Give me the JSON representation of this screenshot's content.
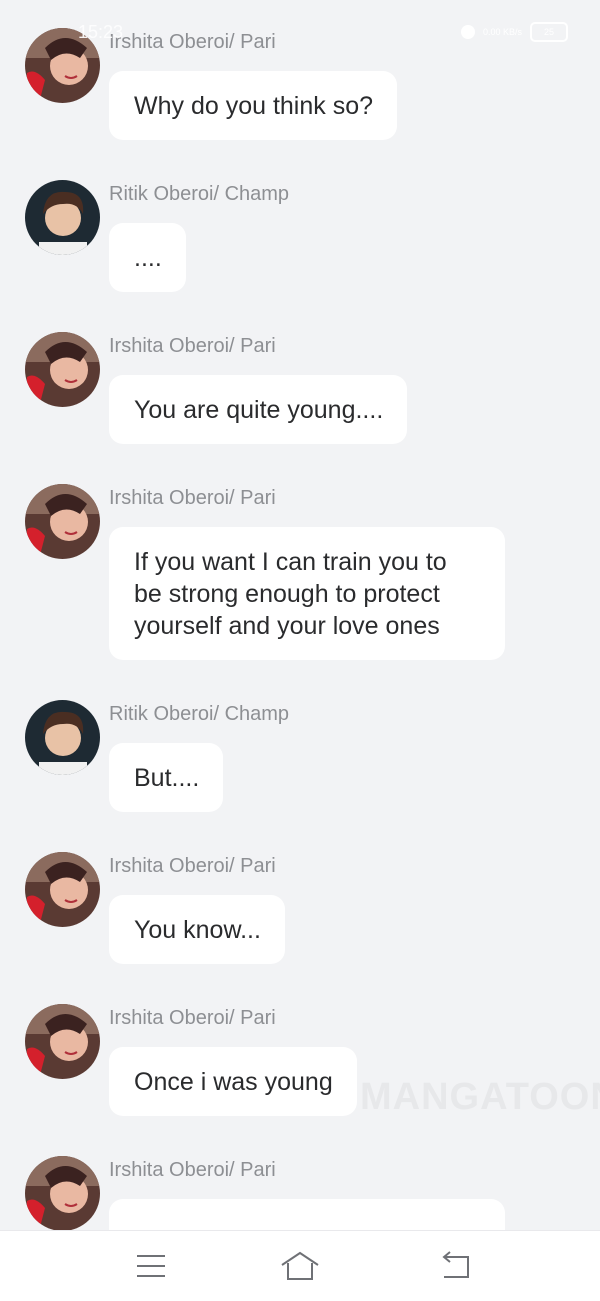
{
  "status_bar": {
    "time": "15:23",
    "net_speed": "0.00 KB/s",
    "battery": "25"
  },
  "watermark": "MANGATOON",
  "messages": [
    {
      "sender": "Irshita Oberoi/ Pari",
      "avatar": "pari-avatar",
      "text": "Why do you think so?"
    },
    {
      "sender": "Ritik Oberoi/ Champ",
      "avatar": "champ-avatar",
      "text": "...."
    },
    {
      "sender": "Irshita Oberoi/ Pari",
      "avatar": "pari-avatar",
      "text": "You are quite young...."
    },
    {
      "sender": "Irshita Oberoi/ Pari",
      "avatar": "pari-avatar",
      "text": "If you want I can train you to be strong enough to protect yourself and your love ones"
    },
    {
      "sender": "Ritik Oberoi/ Champ",
      "avatar": "champ-avatar",
      "text": "But...."
    },
    {
      "sender": "Irshita Oberoi/ Pari",
      "avatar": "pari-avatar",
      "text": "You know..."
    },
    {
      "sender": "Irshita Oberoi/ Pari",
      "avatar": "pari-avatar",
      "text": "Once i was young"
    },
    {
      "sender": "Irshita Oberoi/ Pari",
      "avatar": "pari-avatar",
      "text": ""
    }
  ],
  "nav_bar": {
    "menu_icon": "menu-icon",
    "home_icon": "home-icon",
    "back_icon": "back-icon"
  }
}
